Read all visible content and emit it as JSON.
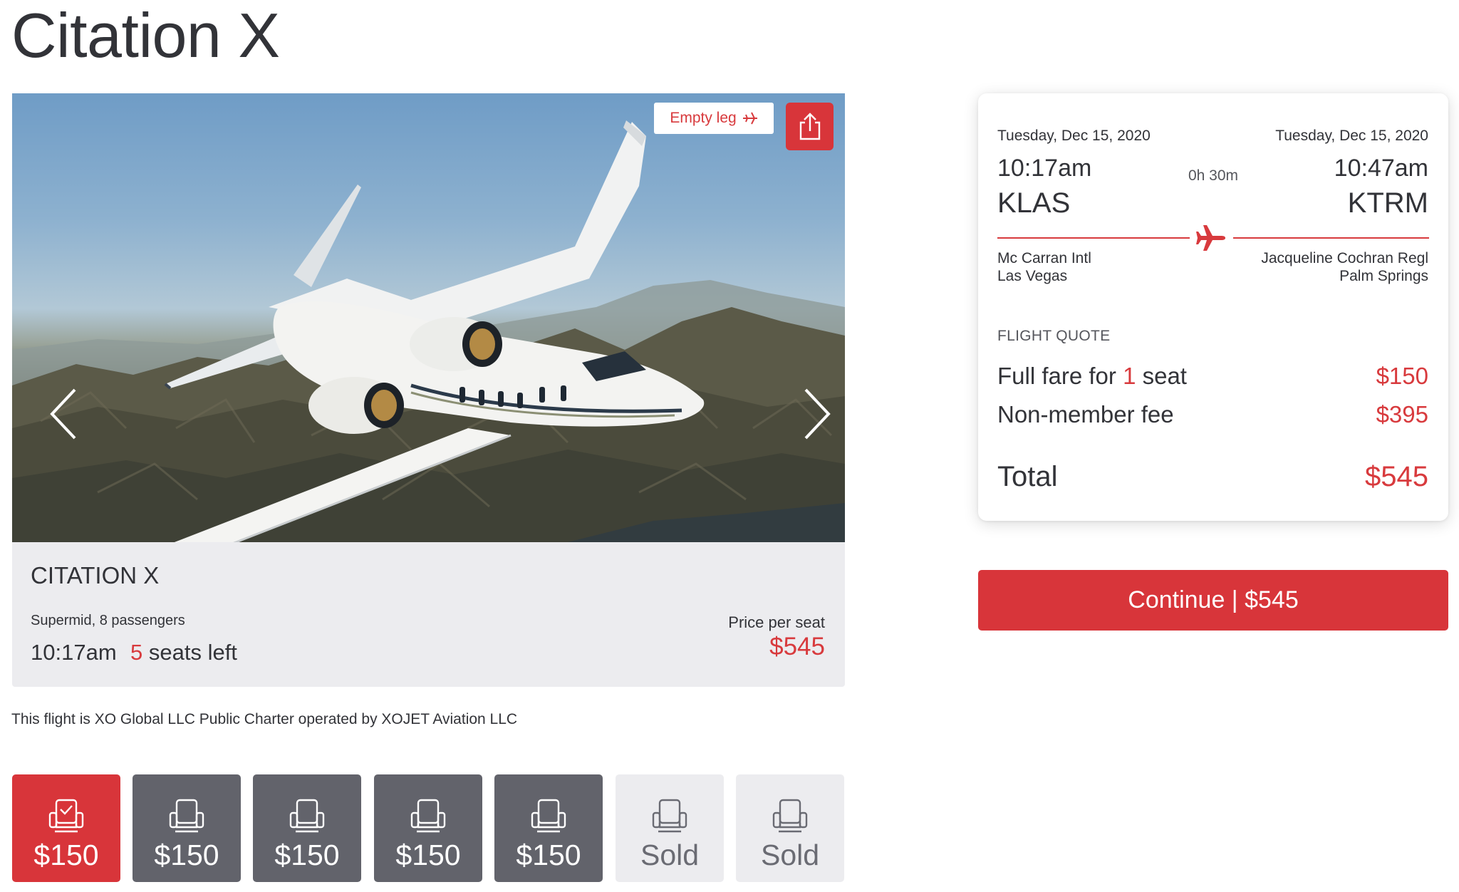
{
  "page": {
    "title": "Citation X"
  },
  "hero": {
    "badge_label": "Empty leg",
    "share_icon": "share-icon",
    "prev_icon": "chevron-left-icon",
    "next_icon": "chevron-right-icon"
  },
  "aircraft": {
    "name": "CITATION X",
    "class": "Supermid, 8 passengers",
    "departure_time": "10:17am",
    "seats_left_count": "5",
    "seats_left_label": " seats left",
    "price_label": "Price per seat",
    "price_value": "$545"
  },
  "operator_note": "This flight is XO Global LLC Public Charter operated by XOJET Aviation LLC",
  "seats": [
    {
      "label": "$150",
      "status": "selected"
    },
    {
      "label": "$150",
      "status": "available"
    },
    {
      "label": "$150",
      "status": "available"
    },
    {
      "label": "$150",
      "status": "available"
    },
    {
      "label": "$150",
      "status": "available"
    },
    {
      "label": "Sold",
      "status": "sold"
    },
    {
      "label": "Sold",
      "status": "sold"
    }
  ],
  "quote": {
    "departure": {
      "date": "Tuesday, Dec 15, 2020",
      "time": "10:17am",
      "code": "KLAS",
      "airport_line1": "Mc Carran Intl",
      "airport_line2": "Las Vegas"
    },
    "arrival": {
      "date": "Tuesday, Dec 15, 2020",
      "time": "10:47am",
      "code": "KTRM",
      "airport_line1": "Jacqueline Cochran Regl",
      "airport_line2": "Palm Springs"
    },
    "duration": "0h 30m",
    "section_title": "FLIGHT QUOTE",
    "fare_label_prefix": "Full fare for ",
    "fare_seat_count": "1",
    "fare_label_suffix": " seat",
    "fare_value": "$150",
    "fee_label": "Non-member fee",
    "fee_value": "$395",
    "total_label": "Total",
    "total_value": "$545"
  },
  "continue_button": "Continue | $545",
  "colors": {
    "accent": "#d8353a",
    "seat_available": "#62636b",
    "panel_gray": "#ececef",
    "text": "#323338"
  }
}
